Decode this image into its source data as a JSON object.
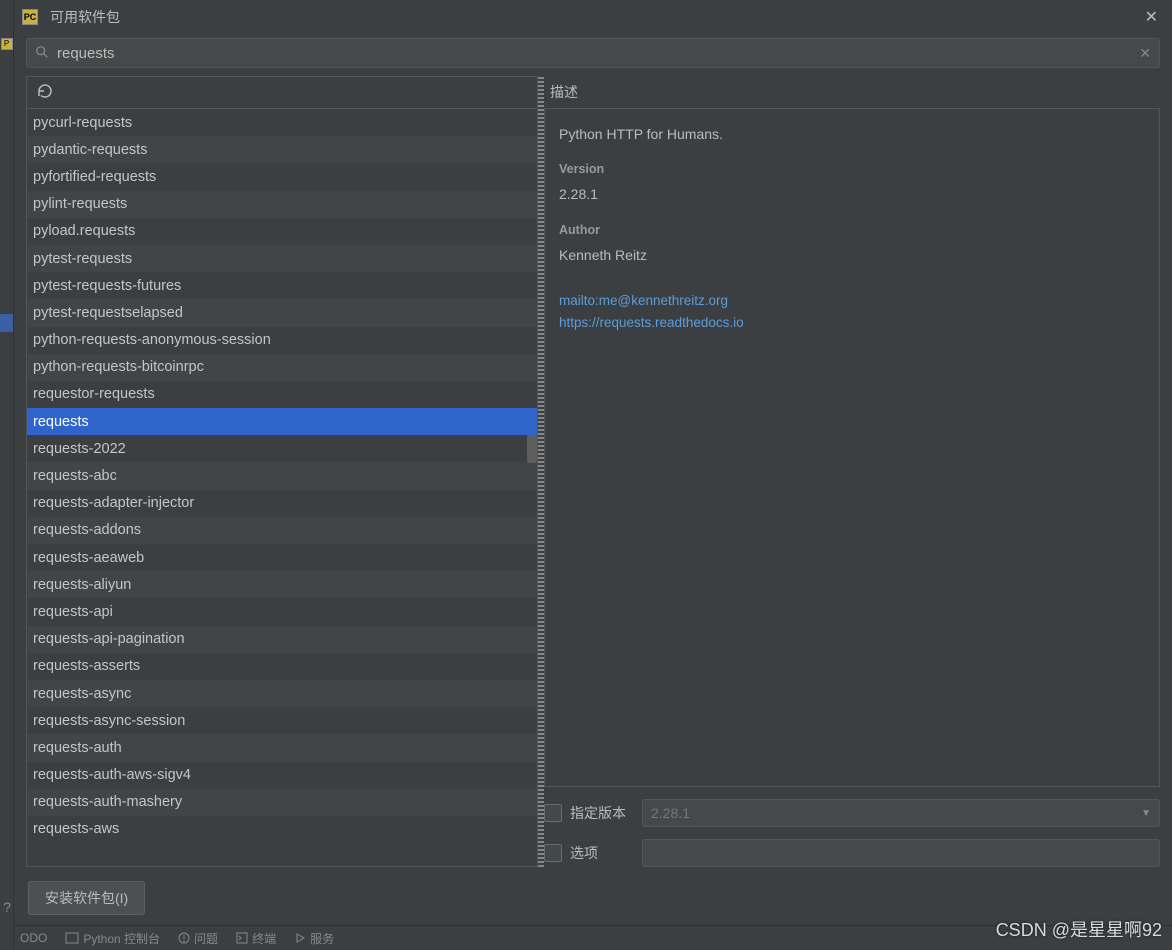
{
  "titlebar": {
    "title": "可用软件包"
  },
  "search": {
    "value": "requests",
    "placeholder": ""
  },
  "packages": [
    "pycurl-requests",
    "pydantic-requests",
    "pyfortified-requests",
    "pylint-requests",
    "pyload.requests",
    "pytest-requests",
    "pytest-requests-futures",
    "pytest-requestselapsed",
    "python-requests-anonymous-session",
    "python-requests-bitcoinrpc",
    "requestor-requests",
    "requests",
    "requests-2022",
    "requests-abc",
    "requests-adapter-injector",
    "requests-addons",
    "requests-aeaweb",
    "requests-aliyun",
    "requests-api",
    "requests-api-pagination",
    "requests-asserts",
    "requests-async",
    "requests-async-session",
    "requests-auth",
    "requests-auth-aws-sigv4",
    "requests-auth-mashery",
    "requests-aws"
  ],
  "selected_package": "requests",
  "detail": {
    "header": "描述",
    "description": "Python HTTP for Humans.",
    "version_label": "Version",
    "version": "2.28.1",
    "author_label": "Author",
    "author": "Kenneth Reitz",
    "email_link": "mailto:me@kennethreitz.org",
    "doc_link": "https://requests.readthedocs.io"
  },
  "footer": {
    "specify_version_label": "指定版本",
    "version_value": "2.28.1",
    "options_label": "选项"
  },
  "install_button": "安装软件包(I)",
  "bottom_bar": {
    "todo": "ODO",
    "console": "Python 控制台",
    "problems": "问题",
    "terminal": "终端",
    "services": "服务"
  },
  "watermark": "CSDN @是星星啊92"
}
